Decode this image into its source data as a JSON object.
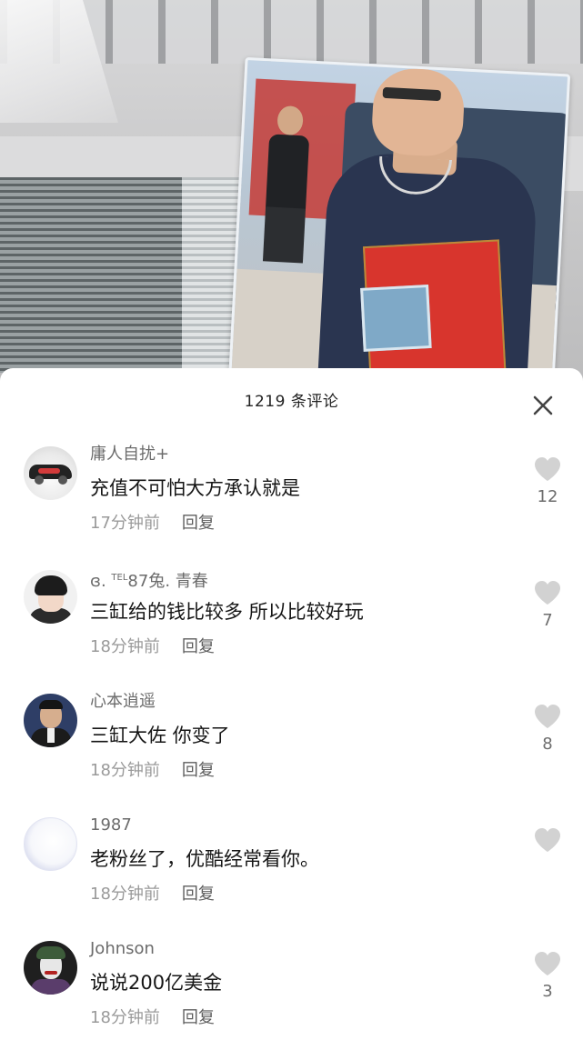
{
  "comments_panel": {
    "count_label": "1219 条评论",
    "close_icon": "close-icon"
  },
  "comments": [
    {
      "avatar": "sports-car-avatar",
      "username": "庸人自扰+",
      "text": "充值不可怕大方承认就是",
      "time": "17分钟前",
      "reply_label": "回复",
      "likes": "12"
    },
    {
      "avatar": "anime-boy-avatar",
      "username_prefix": "ɞ.",
      "username_sup": "TEL",
      "username_suffix": "87兔.  青春",
      "text": "三缸给的钱比较多 所以比较好玩",
      "time": "18分钟前",
      "reply_label": "回复",
      "likes": "7"
    },
    {
      "avatar": "man-in-suit-avatar",
      "username": "心本逍遥",
      "text": "三缸大佐 你变了",
      "time": "18分钟前",
      "reply_label": "回复",
      "likes": "8"
    },
    {
      "avatar": "ring-avatar",
      "username": "1987",
      "text": "老粉丝了，优酷经常看你。",
      "time": "18分钟前",
      "reply_label": "回复",
      "likes": ""
    },
    {
      "avatar": "joker-avatar",
      "username": "Johnson",
      "text": "说说200亿美金",
      "time": "18分钟前",
      "reply_label": "回复",
      "likes": "3"
    }
  ],
  "icons": {
    "like": "heart-icon",
    "close": "close-icon"
  },
  "colors": {
    "sheet_bg": "#ffffff",
    "heart": "#d2d2d2",
    "text_primary": "#161616",
    "text_secondary": "#9a9a9a"
  }
}
